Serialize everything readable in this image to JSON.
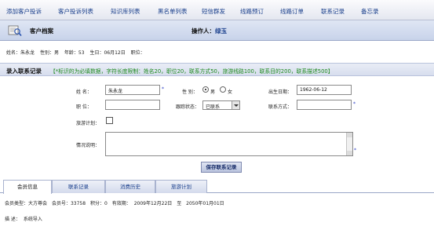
{
  "nav": {
    "items": [
      "添加客户投诉",
      "客户投诉列表",
      "知识库列表",
      "黑名单列表",
      "短信群发",
      "线路预订",
      "线路订单",
      "联系记录",
      "备忘录"
    ]
  },
  "header": {
    "title": "客户档案",
    "operator_label": "操作人：",
    "operator_name": "绿玉"
  },
  "customer": {
    "name": "姓名：朱永龙",
    "gender": "性别：男",
    "age": "年龄：53",
    "birthday": "生日：06月12日",
    "position": "职位："
  },
  "form": {
    "title": "录入联系记录",
    "hint": "【*标识的为必填数据，字符长度限制：姓名20，职位20，联系方式50，旅游线路100，联系目的200，联系描述500】",
    "name_label": "姓    名：",
    "name_value": "朱永龙",
    "gender_label": "性    别：",
    "gender_male": "男",
    "gender_female": "女",
    "birthdate_label": "出生日期：",
    "birthdate_value": "1962-06-12",
    "position_label": "职    位：",
    "position_value": "",
    "followup_label": "跟踪状态：",
    "followup_value": "已联系",
    "contact_label": "联系方式：",
    "contact_value": "",
    "travel_plan_label": "旅游计划：",
    "situation_label": "情况说明：",
    "required_mark": "*",
    "save_label": "保存联系记录"
  },
  "tabs": {
    "items": [
      "会员信息",
      "联系记录",
      "消费历史",
      "旅游计划"
    ],
    "active": 0
  },
  "member": {
    "type": "会员类型：大方尊会",
    "number": "会员号：33758",
    "points": "积分：0",
    "validity_label": "有效期：",
    "valid_from": "2009年12月22日",
    "to": "至",
    "valid_to": "2050年01月01日"
  },
  "remark": {
    "label": "描    述：",
    "value": "系统导入"
  },
  "colors": {
    "nav_text": "#1a3f8c",
    "hint_text": "#1f8a1f",
    "required": "#2a3cc4"
  },
  "icons": {
    "header": "customer-file-icon"
  }
}
